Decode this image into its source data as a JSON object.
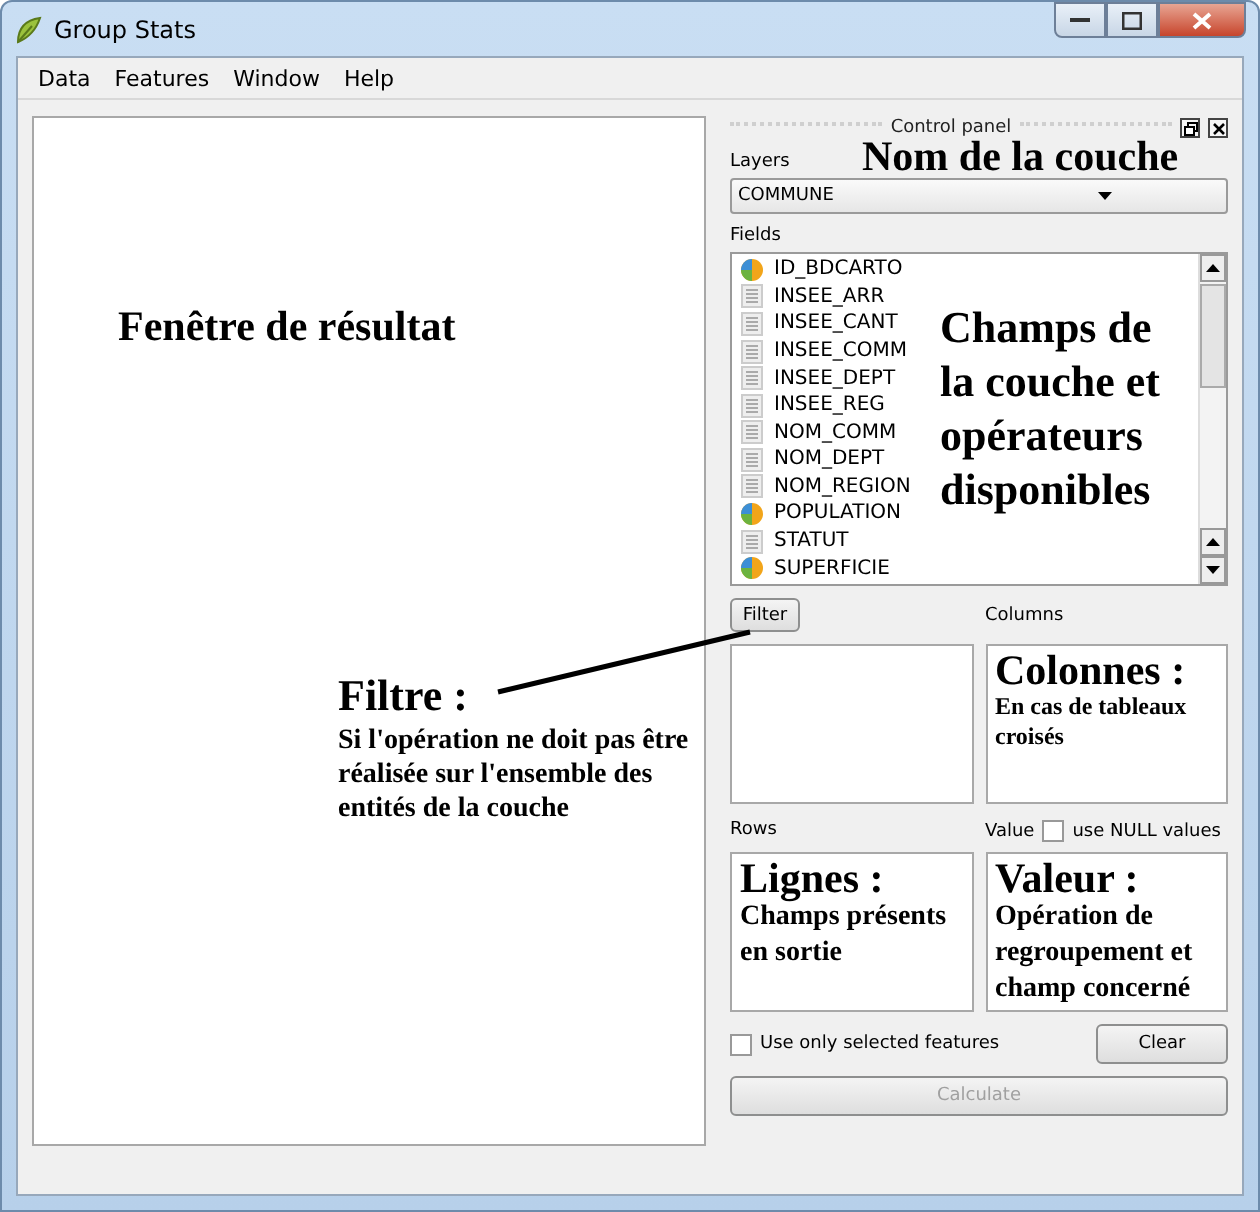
{
  "window": {
    "title": "Group Stats"
  },
  "menu": [
    "Data",
    "Features",
    "Window",
    "Help"
  ],
  "result_note": "Fenêtre de résultat",
  "control_panel": {
    "title": "Control panel",
    "layers_label": "Layers",
    "layer_note": "Nom de la couche",
    "layer_value": "COMMUNE",
    "fields_label": "Fields",
    "fields_note": [
      "Champs de",
      "la couche et",
      "opérateurs",
      "disponibles"
    ],
    "fields": [
      {
        "name": "ID_BDCARTO",
        "kind": "numeric"
      },
      {
        "name": "INSEE_ARR",
        "kind": "text"
      },
      {
        "name": "INSEE_CANT",
        "kind": "text"
      },
      {
        "name": "INSEE_COMM",
        "kind": "text"
      },
      {
        "name": "INSEE_DEPT",
        "kind": "text"
      },
      {
        "name": "INSEE_REG",
        "kind": "text"
      },
      {
        "name": "NOM_COMM",
        "kind": "text"
      },
      {
        "name": "NOM_DEPT",
        "kind": "text"
      },
      {
        "name": "NOM_REGION",
        "kind": "text"
      },
      {
        "name": "POPULATION",
        "kind": "numeric"
      },
      {
        "name": "STATUT",
        "kind": "text"
      },
      {
        "name": "SUPERFICIE",
        "kind": "numeric"
      }
    ],
    "filter_button": "Filter",
    "filter_note": {
      "title": "Filtre :",
      "text": "Si l'opération ne doit pas être réalisée sur l'ensemble des entités de la couche"
    },
    "columns_label": "Columns",
    "columns_note": {
      "title": "Colonnes :",
      "text": "En cas de tableaux croisés"
    },
    "rows_label": "Rows",
    "rows_note": {
      "title": "Lignes :",
      "text": "Champs présents en sortie"
    },
    "value_label": "Value",
    "use_null": {
      "label": "use NULL values",
      "checked": false
    },
    "value_note": {
      "title": "Valeur :",
      "text": "Opération de regroupement et champ concerné"
    },
    "use_selected": {
      "label": "Use only selected features",
      "checked": false
    },
    "clear_button": "Clear",
    "calculate_button": {
      "label": "Calculate",
      "disabled": true
    }
  }
}
